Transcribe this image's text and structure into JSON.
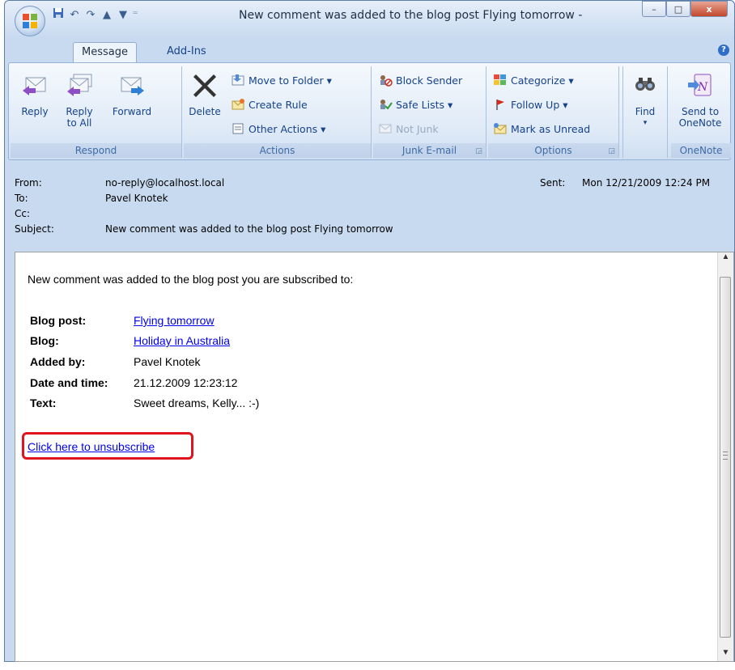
{
  "window": {
    "title": "New comment was added to the blog post Flying tomorrow -",
    "minimize": "–",
    "maximize": "□",
    "close": "x"
  },
  "quick_access": [
    "save-icon",
    "undo-icon",
    "redo-icon",
    "up-arrow-icon",
    "down-arrow-icon",
    "customize-icon"
  ],
  "tabs": [
    {
      "label": "Message",
      "active": true
    },
    {
      "label": "Add-Ins",
      "active": false
    }
  ],
  "ribbon": {
    "respond": {
      "label": "Respond",
      "reply": "Reply",
      "reply_all_line1": "Reply",
      "reply_all_line2": "to All",
      "forward": "Forward"
    },
    "actions": {
      "label": "Actions",
      "delete": "Delete",
      "move_to_folder": "Move to Folder ▾",
      "create_rule": "Create Rule",
      "other_actions": "Other Actions ▾"
    },
    "junk": {
      "label": "Junk E-mail",
      "block_sender": "Block Sender",
      "safe_lists": "Safe Lists ▾",
      "not_junk": "Not Junk"
    },
    "options": {
      "label": "Options",
      "categorize": "Categorize ▾",
      "follow_up": "Follow Up ▾",
      "mark_unread": "Mark as Unread"
    },
    "find": {
      "label": "Find",
      "arrow": "▾"
    },
    "onenote": {
      "label": "OneNote",
      "send_line1": "Send to",
      "send_line2": "OneNote"
    }
  },
  "headers": {
    "from_label": "From:",
    "from_value": "no-reply@localhost.local",
    "to_label": "To:",
    "to_value": "Pavel Knotek",
    "cc_label": "Cc:",
    "cc_value": "",
    "subject_label": "Subject:",
    "subject_value": "New comment was added to the blog post Flying tomorrow",
    "sent_label": "Sent:",
    "sent_value": "Mon 12/21/2009 12:24 PM"
  },
  "message": {
    "intro": "New comment was added to the blog post you are subscribed to:",
    "details": [
      {
        "label": "Blog post:",
        "value": "Flying tomorrow",
        "link": true
      },
      {
        "label": "Blog:",
        "value": "Holiday in Australia",
        "link": true
      },
      {
        "label": "Added by:",
        "value": "Pavel Knotek",
        "link": false
      },
      {
        "label": "Date and time:",
        "value": "21.12.2009 12:23:12",
        "link": false
      },
      {
        "label": "Text:",
        "value": "Sweet dreams, Kelly... :-)",
        "link": false
      }
    ],
    "unsubscribe": "Click here to unsubscribe"
  },
  "colors": {
    "highlight": "#e0141c",
    "link": "#0000ee",
    "ribbon_text": "#15428b"
  }
}
